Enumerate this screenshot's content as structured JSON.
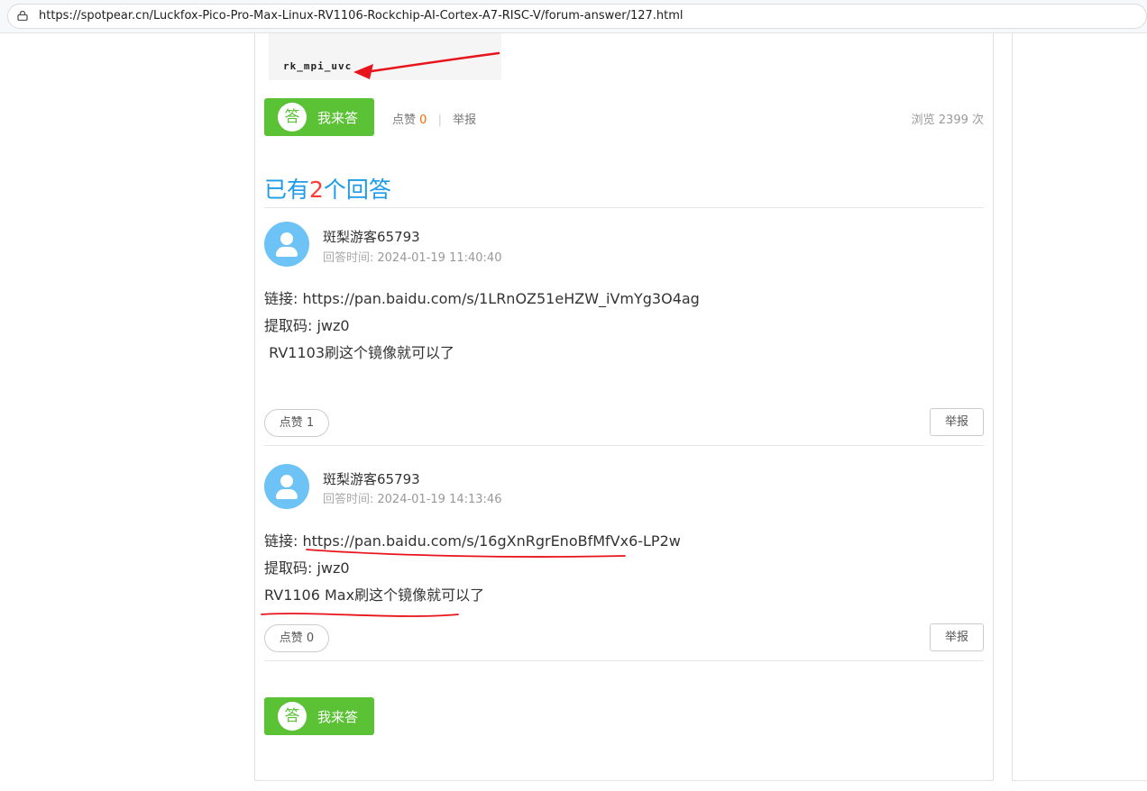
{
  "browser": {
    "url": "https://spotpear.cn/Luckfox-Pico-Pro-Max-Linux-RV1106-Rockchip-AI-Cortex-A7-RISC-V/forum-answer/127.html"
  },
  "question": {
    "code_line_partial": "rk_mpi_uvc",
    "answer_button": {
      "badge": "答",
      "label": "我来答"
    },
    "like_label": "点赞",
    "like_count": "0",
    "report_label": "举报",
    "views_label": "浏览 2399 次"
  },
  "answers_header": {
    "prefix": "已有",
    "count": "2",
    "suffix": "个回答"
  },
  "answers": [
    {
      "user": "斑梨游客65793",
      "time_label": "回答时间:",
      "time": "2024-01-19 11:40:40",
      "lines": [
        "链接: https://pan.baidu.com/s/1LRnOZ51eHZW_iVmYg3O4ag",
        "提取码: jwz0",
        " RV1103刷这个镜像就可以了"
      ],
      "like_button": "点赞 1",
      "report_button": "举报"
    },
    {
      "user": "斑梨游客65793",
      "time_label": "回答时间:",
      "time": "2024-01-19 14:13:46",
      "lines": [
        "链接: https://pan.baidu.com/s/16gXnRgrEnoBfMfVx6-LP2w",
        "提取码: jwz0",
        "RV1106 Max刷这个镜像就可以了"
      ],
      "like_button": "点赞 0",
      "report_button": "举报"
    }
  ],
  "bottom_answer_button": {
    "badge": "答",
    "label": "我来答"
  },
  "colors": {
    "accent_green": "#5bc236",
    "title_blue": "#1e9be8",
    "count_red": "#ff3b3b",
    "annotation_red": "#e8141b",
    "avatar_blue": "#6dc3f5"
  },
  "icons": [
    "lock-icon",
    "user-avatar-icon"
  ]
}
